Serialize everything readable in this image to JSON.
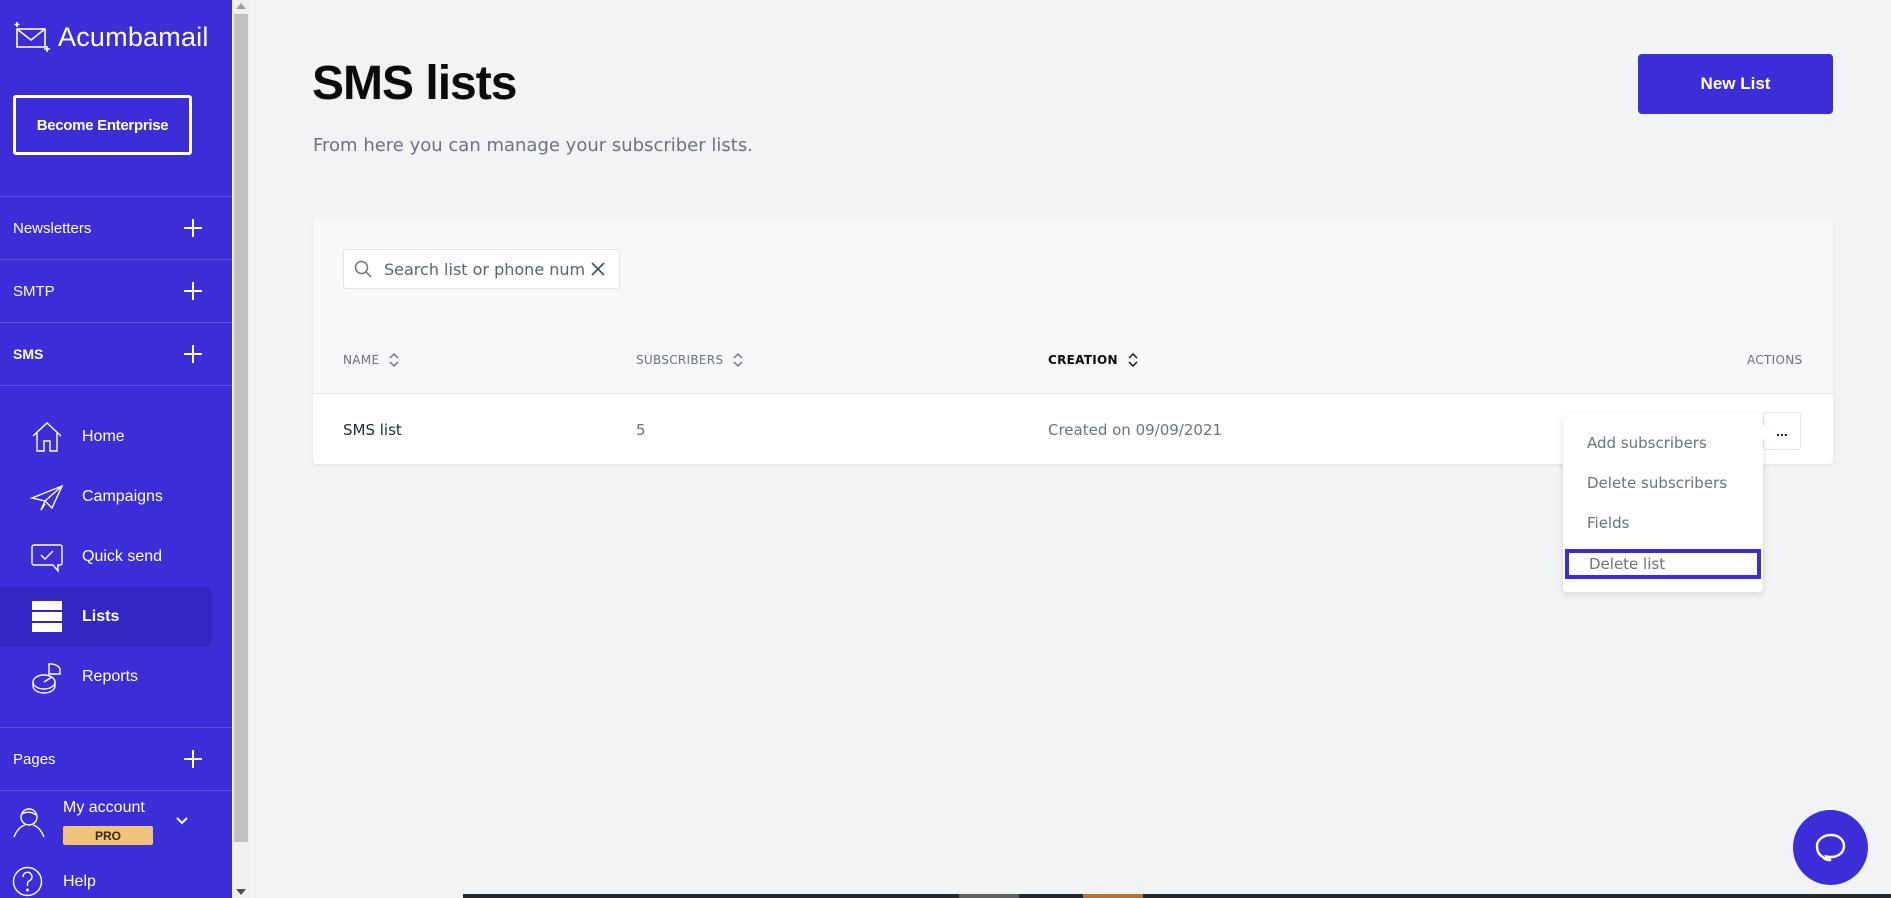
{
  "app": {
    "brand": "Acumbamail",
    "brand_color": "#3b2ed9"
  },
  "sidebar": {
    "enterprise_button": "Become Enterprise",
    "sections": [
      {
        "label": "Newsletters",
        "icon": "plus-icon"
      },
      {
        "label": "SMTP",
        "icon": "plus-icon"
      },
      {
        "label": "SMS",
        "icon": "plus-icon",
        "active": true
      }
    ],
    "nav": [
      {
        "label": "Home",
        "icon": "home-icon"
      },
      {
        "label": "Campaigns",
        "icon": "paper-plane-icon"
      },
      {
        "label": "Quick send",
        "icon": "chat-check-icon"
      },
      {
        "label": "Lists",
        "icon": "list-icon",
        "active": true
      },
      {
        "label": "Reports",
        "icon": "pie-chart-icon"
      }
    ],
    "pages_section": {
      "label": "Pages",
      "icon": "plus-icon"
    },
    "account": {
      "label": "My account",
      "badge": "PRO",
      "badge_color": "#f0c27a"
    },
    "help": {
      "label": "Help"
    }
  },
  "main": {
    "title": "SMS lists",
    "subtitle": "From here you can manage your subscriber lists.",
    "new_list_button": "New List",
    "search": {
      "placeholder": "Search list or phone num",
      "value": ""
    },
    "table": {
      "columns": [
        {
          "label": "NAME",
          "sortable": true
        },
        {
          "label": "SUBSCRIBERS",
          "sortable": true
        },
        {
          "label": "CREATION",
          "sortable": true,
          "active": true
        },
        {
          "label": "ACTIONS",
          "sortable": false
        }
      ],
      "rows": [
        {
          "name": "SMS list",
          "subscribers": "5",
          "creation": "Created on 09/09/2021",
          "actions": "..."
        }
      ]
    },
    "actions_menu": {
      "items": [
        "Add subscribers",
        "Delete subscribers",
        "Fields",
        "Delete list"
      ],
      "focused": "Delete list"
    }
  }
}
